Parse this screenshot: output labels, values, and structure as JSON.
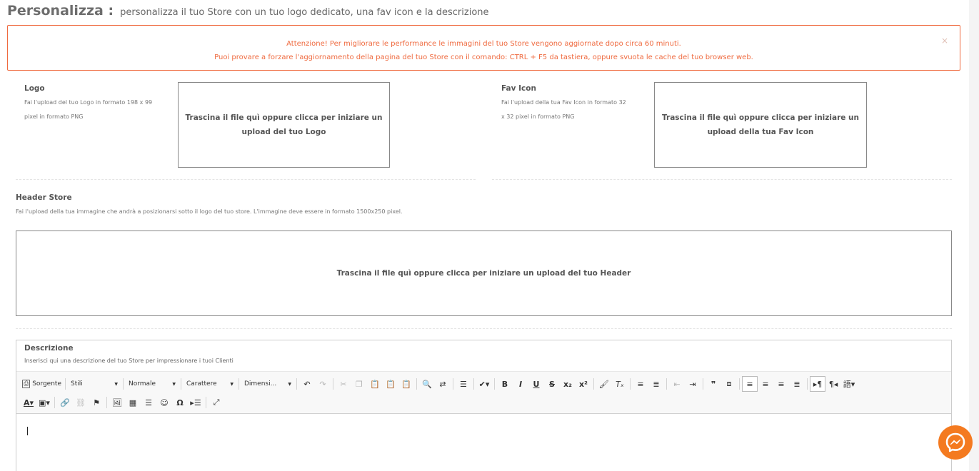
{
  "header": {
    "title": "Personalizza :",
    "subtitle": "personalizza il tuo Store con un tuo logo dedicato, una fav icon e la descrizione"
  },
  "alert": {
    "line1": "Attenzione! Per migliorare le performance le immagini del tuo Store vengono aggiornate dopo circa 60 minuti.",
    "line2": "Puoi provare a forzare l'aggiornamento della pagina del tuo Store con il comando: CTRL + F5 da tastiera, oppure svuota le cache del tuo browser web.",
    "close": "×"
  },
  "logo": {
    "label": "Logo",
    "help_line1": "Fai l'upload del tuo Logo in formato 198 x 99",
    "help_line2": "pixel in formato PNG",
    "drop_line1": "Trascina il file quì oppure clicca per iniziare un",
    "drop_line2": "upload del tuo Logo"
  },
  "favicon": {
    "label": "Fav Icon",
    "help_line1": "Fai l'upload della tua Fav Icon in formato 32",
    "help_line2": "x 32 pixel in formato PNG",
    "drop_line1": "Trascina il file quì oppure clicca per iniziare un",
    "drop_line2": "upload della tua Fav Icon"
  },
  "header_store": {
    "label": "Header Store",
    "help": "Fai l'upload della tua immagine che andrà a posizionarsi sotto il logo del tuo store. L'immagine deve essere in formato 1500x250 pixel.",
    "drop": "Trascina il file quì oppure clicca per iniziare un upload del tuo Header"
  },
  "description": {
    "label": "Descrizione",
    "help": "Inserisci qui una descrizione del tuo Store per impressionare i tuoi Clienti"
  },
  "editor": {
    "source_label": "Sorgente",
    "styles_label": "Stili",
    "format_label": "Normale",
    "font_label": "Carattere",
    "size_label": "Dimensi..."
  },
  "icons": {
    "alert_close": "close-icon",
    "messenger": "messenger-icon"
  },
  "colors": {
    "alert": "#ef6a3f",
    "messenger": "#f47a20"
  }
}
